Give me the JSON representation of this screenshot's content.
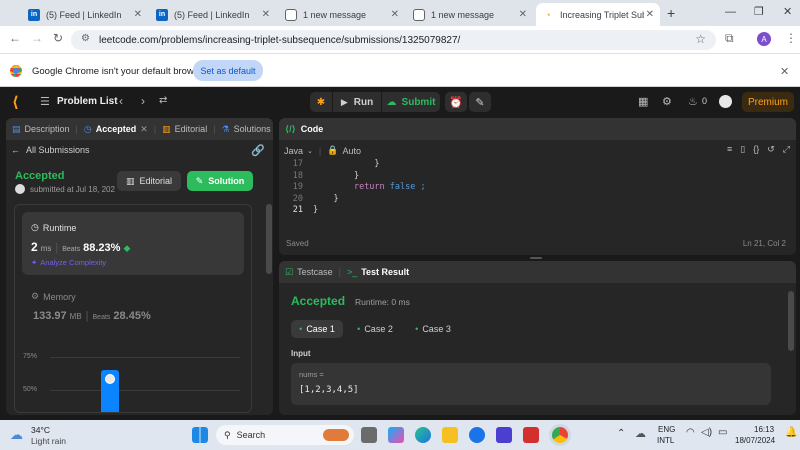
{
  "browser": {
    "tabs": [
      {
        "title": "(5) Feed | LinkedIn",
        "icon": "linkedin-icon"
      },
      {
        "title": "(5) Feed | LinkedIn",
        "icon": "linkedin-icon"
      },
      {
        "title": "1 new message",
        "icon": "message-icon"
      },
      {
        "title": "1 new message",
        "icon": "message-icon"
      },
      {
        "title": "Increasing Triplet Subseq",
        "icon": "leetcode-icon"
      }
    ],
    "url": "leetcode.com/problems/increasing-triplet-subsequence/submissions/1325079827/",
    "profile_initial": "A",
    "infobar_text": "Google Chrome isn't your default browser",
    "infobar_button": "Set as default"
  },
  "lc": {
    "problem_list": "Problem List",
    "run": "Run",
    "submit": "Submit",
    "streak": "0",
    "premium": "Premium"
  },
  "left": {
    "tabs": [
      "Description",
      "Accepted",
      "Editorial",
      "Solutions"
    ],
    "all_submissions": "All Submissions",
    "status": "Accepted",
    "submitted": "submitted at Jul 18, 202",
    "editorial_btn": "Editorial",
    "solution_btn": "Solution",
    "runtime": {
      "label": "Runtime",
      "value": "2",
      "unit": "ms",
      "beats_label": "Beats",
      "beats": "88.23%",
      "analyze": "Analyze Complexity"
    },
    "memory": {
      "label": "Memory",
      "value": "133.97",
      "unit": "MB",
      "beats_label": "Beats",
      "beats": "28.45%"
    },
    "chart": {
      "y_ticks": [
        "75%",
        "50%"
      ]
    }
  },
  "code": {
    "title": "Code",
    "language": "Java",
    "mode": "Auto",
    "lines": [
      {
        "num": "17",
        "text": "            }"
      },
      {
        "num": "18",
        "text": "        }"
      },
      {
        "num": "19",
        "text_kw": "return",
        "text_rest": " false ;",
        "indent": "        "
      },
      {
        "num": "20",
        "text": "    }"
      },
      {
        "num": "21",
        "text": "}"
      }
    ],
    "saved": "Saved",
    "cursor": "Ln 21, Col 2"
  },
  "result": {
    "tabs": [
      "Testcase",
      "Test Result"
    ],
    "status": "Accepted",
    "runtime": "Runtime: 0 ms",
    "cases": [
      "Case 1",
      "Case 2",
      "Case 3"
    ],
    "input_label": "Input",
    "var_name": "nums =",
    "value": "[1,2,3,4,5]"
  },
  "taskbar": {
    "temp": "34°C",
    "weather": "Light rain",
    "search": "Search",
    "lang1": "ENG",
    "lang2": "INTL",
    "time": "16:13",
    "date": "18/07/2024"
  }
}
